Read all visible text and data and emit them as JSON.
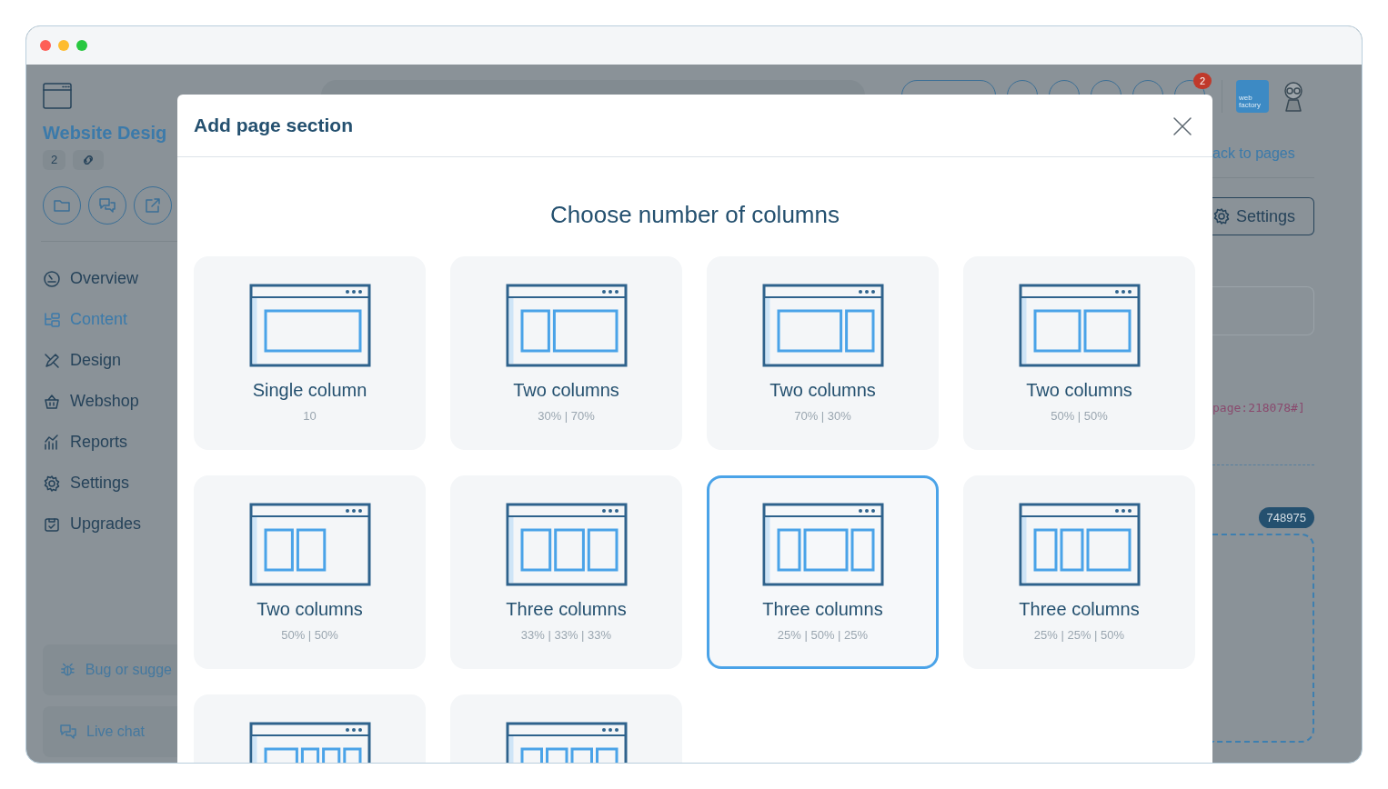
{
  "sidebar": {
    "title": "Website Desig",
    "count": "2",
    "items": [
      {
        "label": "Overview",
        "selected": false
      },
      {
        "label": "Content",
        "selected": true
      },
      {
        "label": "Design",
        "selected": false
      },
      {
        "label": "Webshop",
        "selected": false
      },
      {
        "label": "Reports",
        "selected": false
      },
      {
        "label": "Settings",
        "selected": false
      },
      {
        "label": "Upgrades",
        "selected": false
      }
    ],
    "footer": [
      {
        "label": "Bug or sugge"
      },
      {
        "label": "Live chat"
      }
    ]
  },
  "topbar": {
    "notifications": "2",
    "logo": "web factory"
  },
  "main": {
    "back_link": "ack to pages",
    "settings_button": "Settings",
    "code": "page:218078#]",
    "section_id": "748975"
  },
  "modal": {
    "title": "Add page section",
    "heading": "Choose number of columns",
    "options": [
      {
        "kind": "single",
        "title": "Single column",
        "ratio": "10",
        "selected": false
      },
      {
        "kind": "narrowwide",
        "title": "Two columns",
        "ratio": "30% | 70%",
        "selected": false
      },
      {
        "kind": "widenarrow",
        "title": "Two columns",
        "ratio": "70% | 30%",
        "selected": false
      },
      {
        "kind": "halves",
        "title": "Two columns",
        "ratio": "50% | 50%",
        "selected": false
      },
      {
        "kind": "pillars",
        "title": "Two columns",
        "ratio": "50% | 50%",
        "selected": false
      },
      {
        "kind": "thirds",
        "title": "Three columns",
        "ratio": "33% | 33% | 33%",
        "selected": false
      },
      {
        "kind": "centerwide",
        "title": "Three columns",
        "ratio": "25% | 50% | 25%",
        "selected": true
      },
      {
        "kind": "rightwide",
        "title": "Three columns",
        "ratio": "25% | 25% | 50%",
        "selected": false
      },
      {
        "kind": "widethree",
        "selected": false
      },
      {
        "kind": "quarters",
        "selected": false
      }
    ]
  }
}
